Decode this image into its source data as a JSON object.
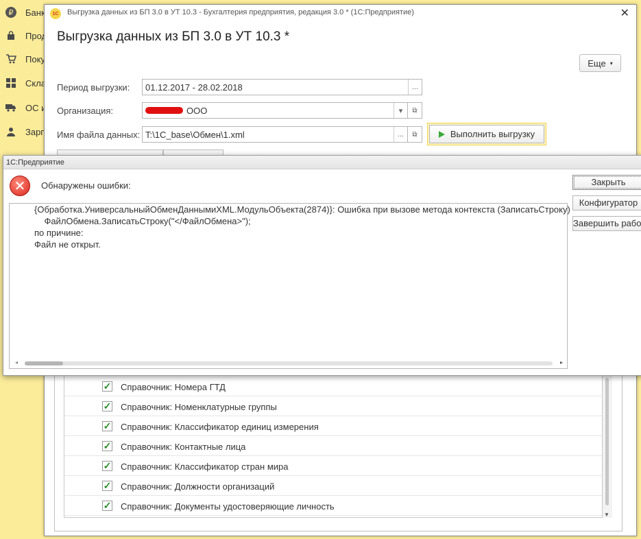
{
  "sidebar": {
    "items": [
      {
        "icon": "ruble-icon",
        "glyph": "₽",
        "label": "Банк"
      },
      {
        "icon": "bag-icon",
        "glyph": "🛍",
        "label": "Прод"
      },
      {
        "icon": "cart-icon",
        "glyph": "🛒",
        "label": "Поку"
      },
      {
        "icon": "grid-icon",
        "glyph": "▦",
        "label": "Скла"
      },
      {
        "icon": "truck-icon",
        "glyph": "🚚",
        "label": "ОС и"
      },
      {
        "icon": "person-icon",
        "glyph": "👤",
        "label": "Зарп"
      }
    ]
  },
  "main_window": {
    "title": "Выгрузка данных из БП 3.0 в УТ 10.3 - Бухгалтерия предприятия, редакция 3.0 *  (1С:Предприятие)",
    "logo_text": "1С",
    "heading": "Выгрузка данных из БП 3.0 в УТ 10.3 *",
    "more_button": "Еще",
    "period_label": "Период выгрузки:",
    "period_value": "01.12.2017 - 28.02.2018",
    "org_label": "Организация:",
    "org_value": "ООО",
    "file_label": "Имя файла данных:",
    "file_value": "T:\\1C_base\\Обмен\\1.xml",
    "run_button": "Выполнить выгрузку"
  },
  "list": {
    "rows": [
      {
        "label": "Справочник: Номера ГТД",
        "checked": true
      },
      {
        "label": "Справочник: Номенклатурные группы",
        "checked": true
      },
      {
        "label": "Справочник: Классификатор единиц измерения",
        "checked": true
      },
      {
        "label": "Справочник: Контактные лица",
        "checked": true
      },
      {
        "label": "Справочник: Классификатор стран мира",
        "checked": true
      },
      {
        "label": "Справочник: Должности организаций",
        "checked": true
      },
      {
        "label": "Справочник: Документы удостоверяющие личность",
        "checked": true
      }
    ]
  },
  "error_dialog": {
    "title": "1С:Предприятие",
    "heading": "Обнаружены ошибки:",
    "message": "{Обработка.УниверсальныйОбменДаннымиXML.МодульОбъекта(2874)}: Ошибка при вызове метода контекста (ЗаписатьСтроку)\n    ФайлОбмена.ЗаписатьСтроку(\"</ФайлОбмена>\");\nпо причине:\nФайл не открыт.",
    "buttons": {
      "close": "Закрыть",
      "configurator": "Конфигуратор",
      "finish": "Завершить работу"
    }
  },
  "colors": {
    "sidebar_bg": "#fbec9a",
    "error_red": "#d9271c",
    "check_green": "#2a8b2a",
    "run_highlight": "#f0d24a"
  }
}
